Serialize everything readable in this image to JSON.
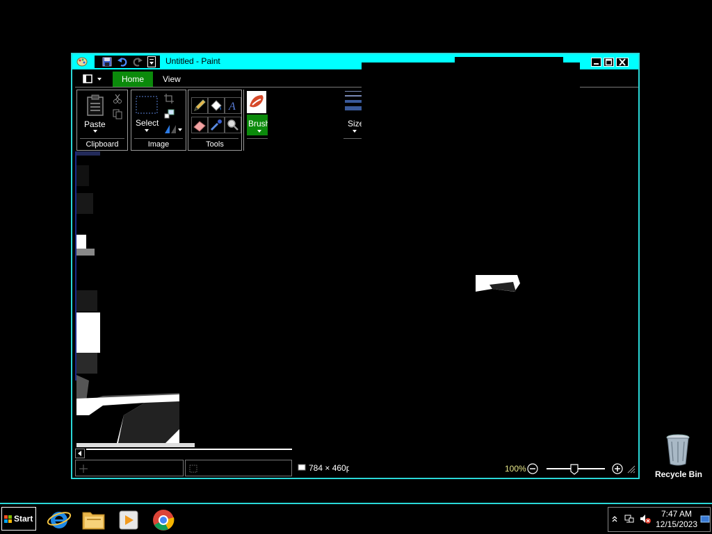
{
  "window": {
    "title": "Untitled - Paint"
  },
  "ribbon": {
    "tabs": [
      {
        "label": "Home",
        "active": true
      },
      {
        "label": "View",
        "active": false
      }
    ],
    "groups": {
      "clipboard": {
        "label": "Clipboard",
        "paste_label": "Paste"
      },
      "image": {
        "label": "Image",
        "select_label": "Select"
      },
      "tools": {
        "label": "Tools"
      },
      "brushes": {
        "label": "Brushes"
      },
      "size": {
        "label": "Size"
      }
    }
  },
  "status": {
    "image_size": "784 × 460px",
    "zoom": "100%"
  },
  "desktop": {
    "recycle_bin_label": "Recycle Bin"
  },
  "taskbar": {
    "start_label": "Start",
    "pinned": [
      {
        "name": "internet-explorer",
        "icon": "ie-icon"
      },
      {
        "name": "file-explorer",
        "icon": "folder-icon"
      },
      {
        "name": "media-player",
        "icon": "media-player-icon"
      },
      {
        "name": "chrome",
        "icon": "chrome-icon"
      }
    ],
    "clock_time": "7:47 AM",
    "clock_date": "12/15/2023"
  },
  "colors": {
    "title_accent": "#00ffff",
    "active_tab": "#0b8a0b",
    "window_border": "#2ad8d8"
  }
}
